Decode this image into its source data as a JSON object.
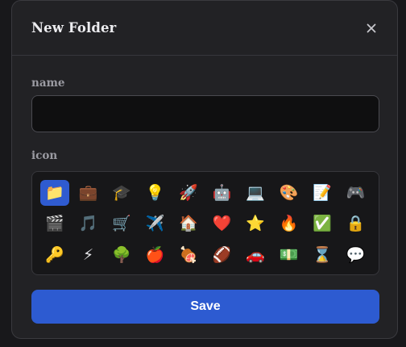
{
  "dialog": {
    "title": "New Folder",
    "close_icon": "close-icon",
    "save_label": "Save"
  },
  "name_field": {
    "label": "name",
    "value": "",
    "placeholder": ""
  },
  "icon_field": {
    "label": "icon",
    "selected_index": 0,
    "icons": [
      {
        "glyph": "📁",
        "name": "folder"
      },
      {
        "glyph": "💼",
        "name": "briefcase"
      },
      {
        "glyph": "🎓",
        "name": "graduation-cap"
      },
      {
        "glyph": "💡",
        "name": "lightbulb"
      },
      {
        "glyph": "🚀",
        "name": "rocket"
      },
      {
        "glyph": "🤖",
        "name": "robot"
      },
      {
        "glyph": "💻",
        "name": "laptop"
      },
      {
        "glyph": "🎨",
        "name": "palette"
      },
      {
        "glyph": "📝",
        "name": "memo"
      },
      {
        "glyph": "🎮",
        "name": "game-controller"
      },
      {
        "glyph": "🎬",
        "name": "clapper-board"
      },
      {
        "glyph": "🎵",
        "name": "music-note"
      },
      {
        "glyph": "🛒",
        "name": "shopping-cart"
      },
      {
        "glyph": "✈️",
        "name": "airplane"
      },
      {
        "glyph": "🏠",
        "name": "house"
      },
      {
        "glyph": "❤️",
        "name": "heart"
      },
      {
        "glyph": "⭐",
        "name": "star"
      },
      {
        "glyph": "🔥",
        "name": "fire"
      },
      {
        "glyph": "✅",
        "name": "check-mark"
      },
      {
        "glyph": "🔒",
        "name": "lock"
      },
      {
        "glyph": "🔑",
        "name": "key"
      },
      {
        "glyph": "⚡",
        "name": "lightning"
      },
      {
        "glyph": "🌳",
        "name": "tree"
      },
      {
        "glyph": "🍎",
        "name": "apple"
      },
      {
        "glyph": "🍖",
        "name": "meat-on-bone"
      },
      {
        "glyph": "🏈",
        "name": "football"
      },
      {
        "glyph": "🚗",
        "name": "car"
      },
      {
        "glyph": "💵",
        "name": "money"
      },
      {
        "glyph": "⌛",
        "name": "hourglass"
      },
      {
        "glyph": "💬",
        "name": "speech-bubble"
      }
    ]
  },
  "colors": {
    "accent": "#2d5bd1",
    "background": "#222225",
    "input_background": "#0f0f10"
  }
}
